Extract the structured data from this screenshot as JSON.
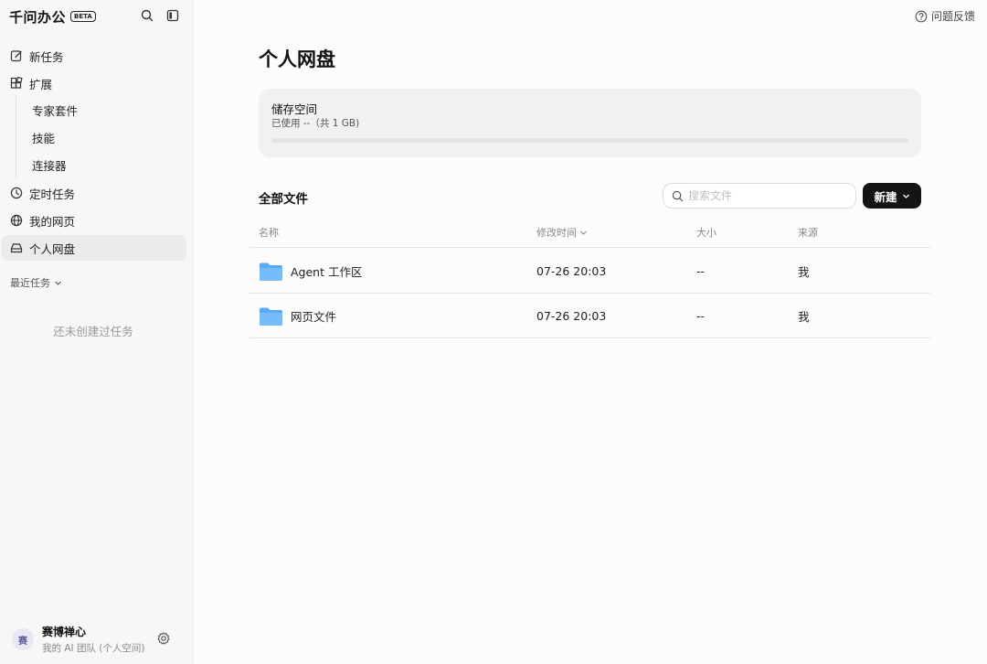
{
  "app": {
    "name": "千问办公",
    "badge": "BETA"
  },
  "sidebar": {
    "nav": [
      {
        "label": "新任务",
        "icon": "edit-icon"
      },
      {
        "label": "扩展",
        "icon": "extensions-icon"
      }
    ],
    "sub_items": [
      {
        "label": "专家套件"
      },
      {
        "label": "技能"
      },
      {
        "label": "连接器"
      }
    ],
    "nav2": [
      {
        "label": "定时任务",
        "icon": "clock-icon"
      },
      {
        "label": "我的网页",
        "icon": "globe-icon"
      },
      {
        "label": "个人网盘",
        "icon": "drive-icon",
        "active": true
      }
    ],
    "recent_label": "最近任务",
    "empty_tasks": "还未创建过任务",
    "user": {
      "avatar": "赛",
      "name": "赛博禅心",
      "subtitle": "我的 AI 团队 (个人空间)"
    }
  },
  "header": {
    "feedback": "问题反馈"
  },
  "main": {
    "title": "个人网盘",
    "storage": {
      "title": "储存空间",
      "used": "已使用 --（共 1 GB)",
      "used_fraction": 0
    },
    "files_title": "全部文件",
    "search_placeholder": "搜索文件",
    "new_button": "新建",
    "columns": {
      "name": "名称",
      "modified": "修改时间",
      "size": "大小",
      "source": "来源"
    },
    "files": [
      {
        "name": "Agent 工作区",
        "modified": "07-26 20:03",
        "size": "--",
        "source": "我"
      },
      {
        "name": "网页文件",
        "modified": "07-26 20:03",
        "size": "--",
        "source": "我"
      }
    ]
  },
  "colors": {
    "accent": "#141414",
    "folder": "#5aa9f4",
    "active_bg": "#ebebeb"
  }
}
